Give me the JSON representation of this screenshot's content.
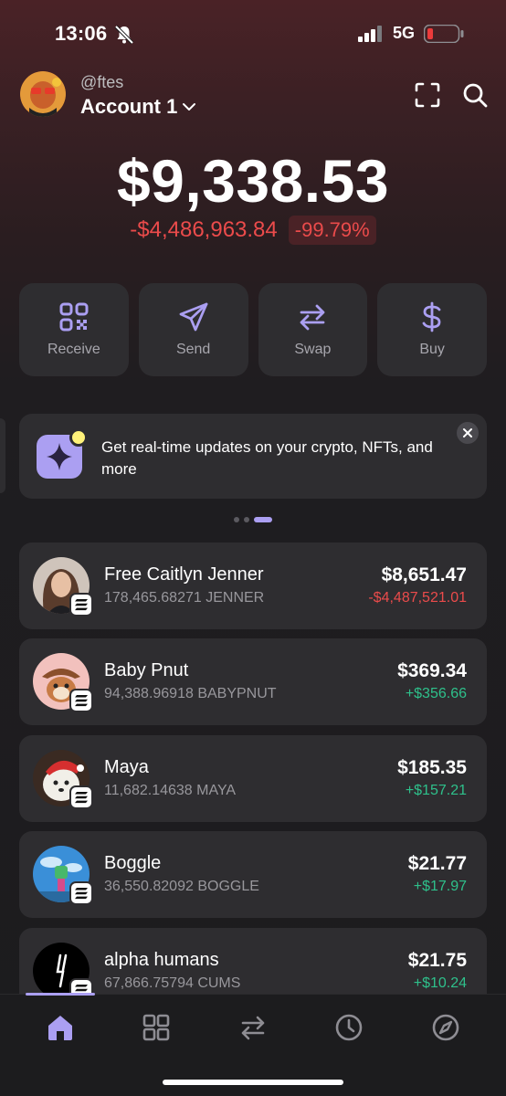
{
  "status_bar": {
    "time": "13:06",
    "network": "5G"
  },
  "header": {
    "handle": "@ftes",
    "account_name": "Account 1"
  },
  "balance": {
    "total": "$9,338.53",
    "change_amount": "-$4,486,963.84",
    "change_percent": "-99.79%"
  },
  "actions": [
    {
      "label": "Receive",
      "icon": "qr-code-icon"
    },
    {
      "label": "Send",
      "icon": "send-icon"
    },
    {
      "label": "Swap",
      "icon": "swap-icon"
    },
    {
      "label": "Buy",
      "icon": "dollar-icon"
    }
  ],
  "banner": {
    "text": "Get real-time updates on your crypto, NFTs, and more"
  },
  "tokens": [
    {
      "name": "Free Caitlyn Jenner",
      "amount": "178,465.68271 JENNER",
      "value": "$8,651.47",
      "change": "-$4,487,521.01",
      "direction": "neg"
    },
    {
      "name": "Baby Pnut",
      "amount": "94,388.96918 BABYPNUT",
      "value": "$369.34",
      "change": "+$356.66",
      "direction": "pos"
    },
    {
      "name": "Maya",
      "amount": "11,682.14638 MAYA",
      "value": "$185.35",
      "change": "+$157.21",
      "direction": "pos"
    },
    {
      "name": "Boggle",
      "amount": "36,550.82092 BOGGLE",
      "value": "$21.77",
      "change": "+$17.97",
      "direction": "pos"
    },
    {
      "name": "alpha humans",
      "amount": "67,866.75794 CUMS",
      "value": "$21.75",
      "change": "+$10.24",
      "direction": "pos"
    }
  ],
  "nav": [
    "home-icon",
    "grid-icon",
    "swap-icon",
    "clock-icon",
    "compass-icon"
  ],
  "colors": {
    "accent": "#ab9ff2",
    "positive": "#2ec08b",
    "negative": "#eb4b4b",
    "card": "#2e2d30"
  }
}
